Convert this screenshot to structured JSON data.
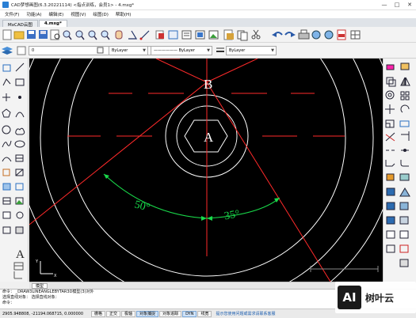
{
  "window": {
    "title": "CAD梦想画图(6.3.20221114) <指点训练，会员1> - 4.mxg*",
    "min": "—",
    "max": "□",
    "close": "✕"
  },
  "menu": [
    "文件(F)",
    "功能(A)",
    "编辑(E)",
    "视图(V)",
    "绘图(D)",
    "帮助(H)"
  ],
  "doc_tabs": [
    {
      "label": "MxCAD云图",
      "active": false
    },
    {
      "label": "4.mxg*",
      "active": true
    }
  ],
  "layer_combo": "0",
  "color_combo": "ByLayer",
  "linetype_combo": "—————— ByLayer",
  "lineweight_combo": "ByLayer",
  "drawing": {
    "label_b": "B",
    "label_a": "A",
    "angle_left": "50°",
    "angle_right": "35°",
    "colors": {
      "line": "#ff2a2a",
      "arc": "#ffffff",
      "dim": "#19d94a"
    }
  },
  "layout_tabs": [
    "模型"
  ],
  "command": {
    "lines": [
      "命令： _DRAW3LINEANGLEBYTAR3D模型(3)对外",
      "选择直线对象： 选择直线对象：",
      "命令："
    ]
  },
  "status": {
    "coords": "2905.948808,  -21194.068715,  0.000000",
    "buttons": [
      {
        "label": "栅格",
        "on": false
      },
      {
        "label": "正交",
        "on": false
      },
      {
        "label": "极轴",
        "on": false
      },
      {
        "label": "对象捕捉",
        "on": true
      },
      {
        "label": "对象追踪",
        "on": false
      },
      {
        "label": "DYN",
        "on": true
      },
      {
        "label": "线宽",
        "on": false
      }
    ],
    "link": "提示您使用问题或需求请联系客服"
  },
  "watermark": {
    "logo": "AI",
    "text": "树叶云"
  },
  "ucs": {
    "x": "X",
    "y": "Y"
  }
}
